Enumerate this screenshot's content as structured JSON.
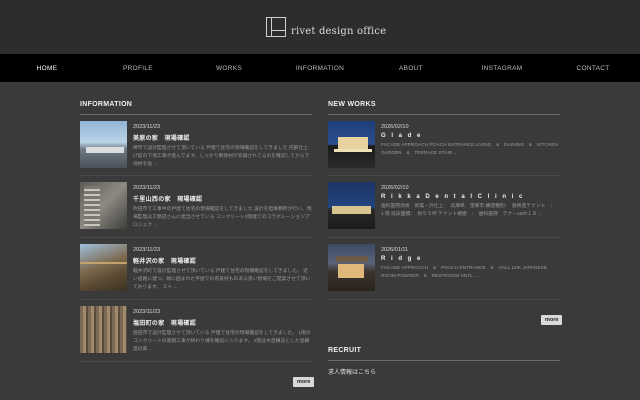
{
  "brand": {
    "name": "rivet design office"
  },
  "nav": [
    {
      "label": "HOME",
      "active": true
    },
    {
      "label": "PROFILE",
      "active": false
    },
    {
      "label": "WORKS",
      "active": false
    },
    {
      "label": "INFORMATION",
      "active": false
    },
    {
      "label": "ABOUT",
      "active": false
    },
    {
      "label": "INSTAGRAM",
      "active": false
    },
    {
      "label": "CONTACT",
      "active": false
    }
  ],
  "information": {
    "title": "INFORMATION",
    "more_label": "more",
    "items": [
      {
        "date": "2023/11/23",
        "title": "美原の家　現場確認",
        "excerpt": "堺市で設計監理させて頂いている 戸建て住宅の現場確認をしてきました 内部仕上げ前の下地工事が進んでます。しっかり断熱材が充填されてるのを確認してから下地材を貼 ..."
      },
      {
        "date": "2023/11/23",
        "title": "千里山西の家　現場確認",
        "excerpt": "吹田市で工事中の戸建て住宅の現場確認をしてきました 設計を担事務所が行い、現場監理は工務店さんに担当させている コンクリート2階建てのコラボレーションプロジェク ..."
      },
      {
        "date": "2023/11/23",
        "title": "軽井沢の家　現場確認",
        "excerpt": "軽井沢町で設計監理させて頂いている 戸建て住宅の現場確認をしてきました。 近い道路に建つ、緑に囲まれた平屋での有良好ものある良い現場をご提案させて頂いております。 スト ..."
      },
      {
        "date": "2023/11/23",
        "title": "塩田町の家　現場確認",
        "excerpt": "鹿田市で設計監理させて頂いている 戸建て住宅の現場確認をしてきました。 1階のコンクリートの基礎工事が終わり棟を確認に入ります。 2階は木造構法とした混構造の家 ..."
      }
    ]
  },
  "new_works": {
    "title": "NEW WORKS",
    "more_label": "more",
    "items": [
      {
        "date": "2026/02/10",
        "title": "G l a d e",
        "excerpt": "FACADE APPROACH  POACH  ENTRANCE LIVING　&　DAINING　&　KITCHEN GARDEN　&　TERRACE STAIR ..."
      },
      {
        "date": "2026/02/10",
        "title": "R i k k a   D e n t a l   C l i n i c",
        "excerpt": "歯科医院改修　新築・外仕上：　兵庫県　宝塚市 構造種別：　鉄骨造テナント　：　1 階 延床面積：　約５５坪 テナント規模　：　歯科医院　テナー45ｍ１８ ..."
      },
      {
        "date": "2026/01/11",
        "title": "R i d g e",
        "excerpt": "FACADE APPROACH　&　POACH ENTRANCE　&　HALL LDK JAPANESE ROOM POWDER　&　RESTROOM SNTL ..."
      }
    ]
  },
  "recruit": {
    "title": "RECRUIT",
    "link_label": "求人情報はこちら"
  }
}
